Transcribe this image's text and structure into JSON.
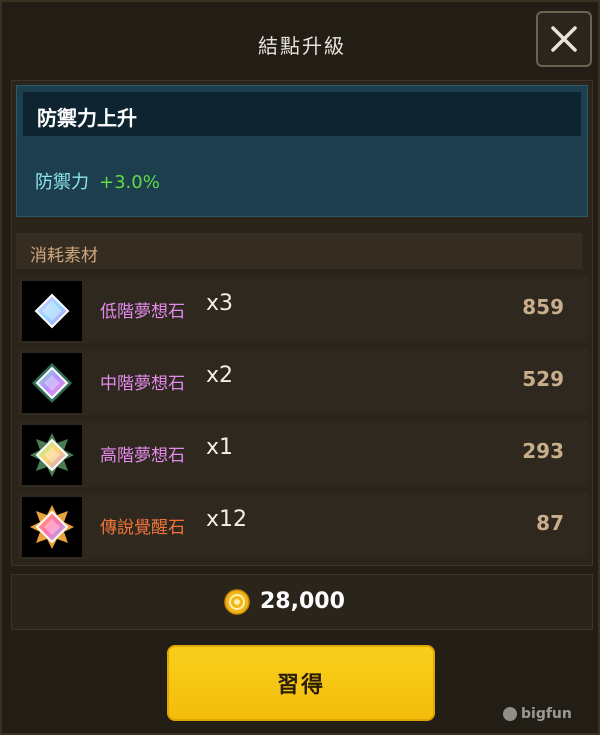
{
  "dialog": {
    "title": "結點升級",
    "close_icon": "close-icon"
  },
  "effect": {
    "title": "防禦力上升",
    "stat_name": "防禦力",
    "stat_value": "+3.0%"
  },
  "materials": {
    "label": "消耗素材",
    "items": [
      {
        "name": "低階夢想石",
        "qty": "x3",
        "owned": "859",
        "name_color": "#e58bf0",
        "icon": "low-dream-stone-icon"
      },
      {
        "name": "中階夢想石",
        "qty": "x2",
        "owned": "529",
        "name_color": "#e58bf0",
        "icon": "mid-dream-stone-icon"
      },
      {
        "name": "高階夢想石",
        "qty": "x1",
        "owned": "293",
        "name_color": "#e58bf0",
        "icon": "high-dream-stone-icon"
      },
      {
        "name": "傳說覺醒石",
        "qty": "x12",
        "owned": "87",
        "name_color": "#f0743a",
        "icon": "legend-awaken-stone-icon"
      }
    ]
  },
  "cost": {
    "icon": "gold-coin-icon",
    "value": "28,000"
  },
  "action": {
    "learn_label": "習得"
  },
  "watermark": {
    "text": "bigfun"
  }
}
